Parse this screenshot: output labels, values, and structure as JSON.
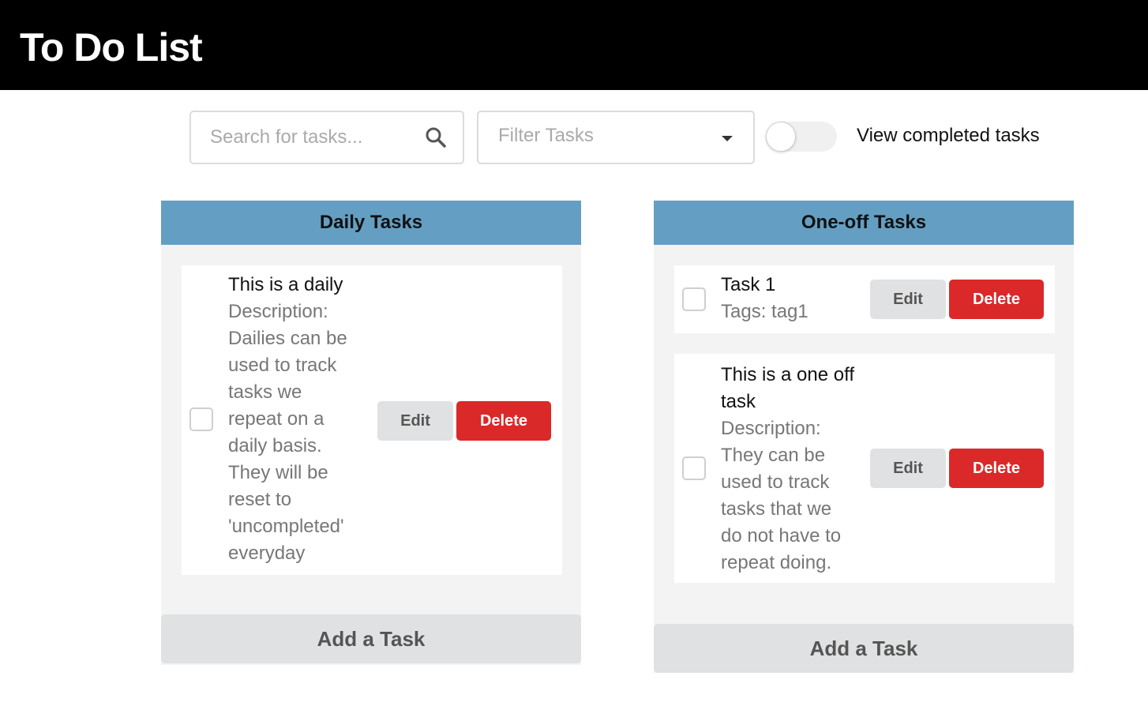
{
  "app": {
    "title": "To Do List"
  },
  "toolbar": {
    "search_placeholder": "Search for tasks...",
    "filter_placeholder": "Filter Tasks",
    "toggle_label": "View completed tasks",
    "toggle_on": false
  },
  "columns": [
    {
      "title": "Daily Tasks",
      "add_label": "Add a Task",
      "tasks": [
        {
          "title": "This is a daily",
          "description_lines": [
            "Description:",
            "Dailies can be",
            "used to track",
            "tasks we",
            "repeat on a",
            "daily basis.",
            "They will be",
            "reset to",
            "'uncompleted'",
            "everyday"
          ],
          "edit_label": "Edit",
          "delete_label": "Delete",
          "checked": false
        }
      ]
    },
    {
      "title": "One-off Tasks",
      "add_label": "Add a Task",
      "tasks": [
        {
          "title": "Task 1",
          "tags": "Tags: tag1",
          "edit_label": "Edit",
          "delete_label": "Delete",
          "checked": false
        },
        {
          "title_lines": [
            "This is a one off",
            "task"
          ],
          "description_lines": [
            "Description:",
            "They can be",
            "used to track",
            "tasks that we",
            "do not have to",
            "repeat doing."
          ],
          "edit_label": "Edit",
          "delete_label": "Delete",
          "checked": false
        }
      ]
    }
  ],
  "colors": {
    "header_bg": "#000000",
    "column_header": "#649fc3",
    "column_bg": "#f3f3f3",
    "delete": "#db2828",
    "neutral_button": "#e0e1e2"
  }
}
